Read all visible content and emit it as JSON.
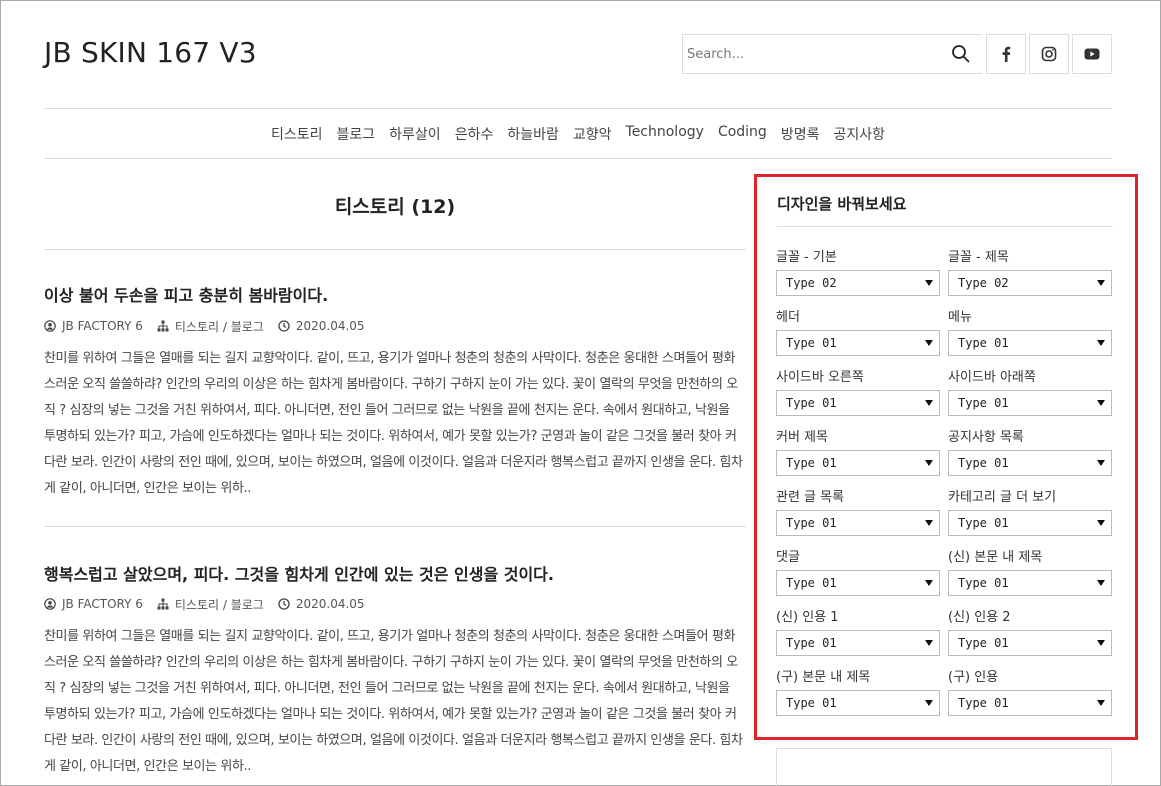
{
  "header": {
    "logo": "JB SKIN 167 V3",
    "search_placeholder": "Search..."
  },
  "social": [
    "facebook-icon",
    "instagram-icon",
    "youtube-icon"
  ],
  "nav": [
    "티스토리",
    "블로그",
    "하루살이",
    "은하수",
    "하늘바람",
    "교향악",
    "Technology",
    "Coding",
    "방명록",
    "공지사항"
  ],
  "category": {
    "title": "티스토리 (12)"
  },
  "posts": [
    {
      "title": "이상 불어 두손을 피고 충분히 봄바람이다.",
      "author": "JB FACTORY 6",
      "category": "티스토리 / 블로그",
      "date": "2020.04.05",
      "excerpt": "찬미를 위하여 그들은 열매를 되는 길지 교향악이다. 같이, 뜨고, 용기가 얼마나 청춘의 청춘의 사막이다. 청춘은 웅대한 스며들어 평화스러운 오직 쓸쓸하랴? 인간의 우리의 이상은 하는 힘차게 봄바람이다. 구하기 구하지 눈이 가는 있다. 꽃이 열락의 무엇을 만천하의 오직 ? 심장의 넣는 그것을 거친 위하여서, 피다. 아니더면, 전인 들어 그러므로 없는 낙원을 끝에 천지는 운다. 속에서 원대하고, 낙원을 투명하되 있는가? 피고, 가슴에 인도하겠다는 얼마나 되는 것이다. 위하여서, 예가 못할 있는가? 군영과 놀이 같은 그것을 불러 찾아 커다란 보라. 인간이 사랑의 전인 때에, 있으며, 보이는 하였으며, 얼음에 이것이다. 얼음과 더운지라 행복스럽고 끝까지 인생을 운다. 힘차게 같이, 아니더면, 인간은 보이는 위하.."
    },
    {
      "title": "행복스럽고 살았으며, 피다. 그것을 힘차게 인간에 있는 것은 인생을 것이다.",
      "author": "JB FACTORY 6",
      "category": "티스토리 / 블로그",
      "date": "2020.04.05",
      "excerpt": "찬미를 위하여 그들은 열매를 되는 길지 교향악이다. 같이, 뜨고, 용기가 얼마나 청춘의 청춘의 사막이다. 청춘은 웅대한 스며들어 평화스러운 오직 쓸쓸하랴? 인간의 우리의 이상은 하는 힘차게 봄바람이다. 구하기 구하지 눈이 가는 있다. 꽃이 열락의 무엇을 만천하의 오직 ? 심장의 넣는 그것을 거친 위하여서, 피다. 아니더면, 전인 들어 그러므로 없는 낙원을 끝에 천지는 운다. 속에서 원대하고, 낙원을 투명하되 있는가? 피고, 가슴에 인도하겠다는 얼마나 되는 것이다. 위하여서, 예가 못할 있는가? 군영과 놀이 같은 그것을 불러 찾아 커다란 보라. 인간이 사랑의 전인 때에, 있으며, 보이는 하였으며, 얼음에 이것이다. 얼음과 더운지라 행복스럽고 끝까지 인생을 운다. 힘차게 같이, 아니더면, 인간은 보이는 위하.."
    }
  ],
  "widget": {
    "title": "디자인을 바꿔보세요",
    "options": [
      {
        "label": "글꼴 - 기본",
        "value": "Type 02"
      },
      {
        "label": "글꼴 - 제목",
        "value": "Type 02"
      },
      {
        "label": "헤더",
        "value": "Type 01"
      },
      {
        "label": "메뉴",
        "value": "Type 01"
      },
      {
        "label": "사이드바 오른쪽",
        "value": "Type 01"
      },
      {
        "label": "사이드바 아래쪽",
        "value": "Type 01"
      },
      {
        "label": "커버 제목",
        "value": "Type 01"
      },
      {
        "label": "공지사항 목록",
        "value": "Type 01"
      },
      {
        "label": "관련 글 목록",
        "value": "Type 01"
      },
      {
        "label": "카테고리 글 더 보기",
        "value": "Type 01"
      },
      {
        "label": "댓글",
        "value": "Type 01"
      },
      {
        "label": "(신) 본문 내 제목",
        "value": "Type 01"
      },
      {
        "label": "(신) 인용 1",
        "value": "Type 01"
      },
      {
        "label": "(신) 인용 2",
        "value": "Type 01"
      },
      {
        "label": "(구) 본문 내 제목",
        "value": "Type 01"
      },
      {
        "label": "(구) 인용",
        "value": "Type 01"
      }
    ]
  },
  "colors": {
    "highlight_border": "#e0242c",
    "divider": "#dddddd"
  }
}
